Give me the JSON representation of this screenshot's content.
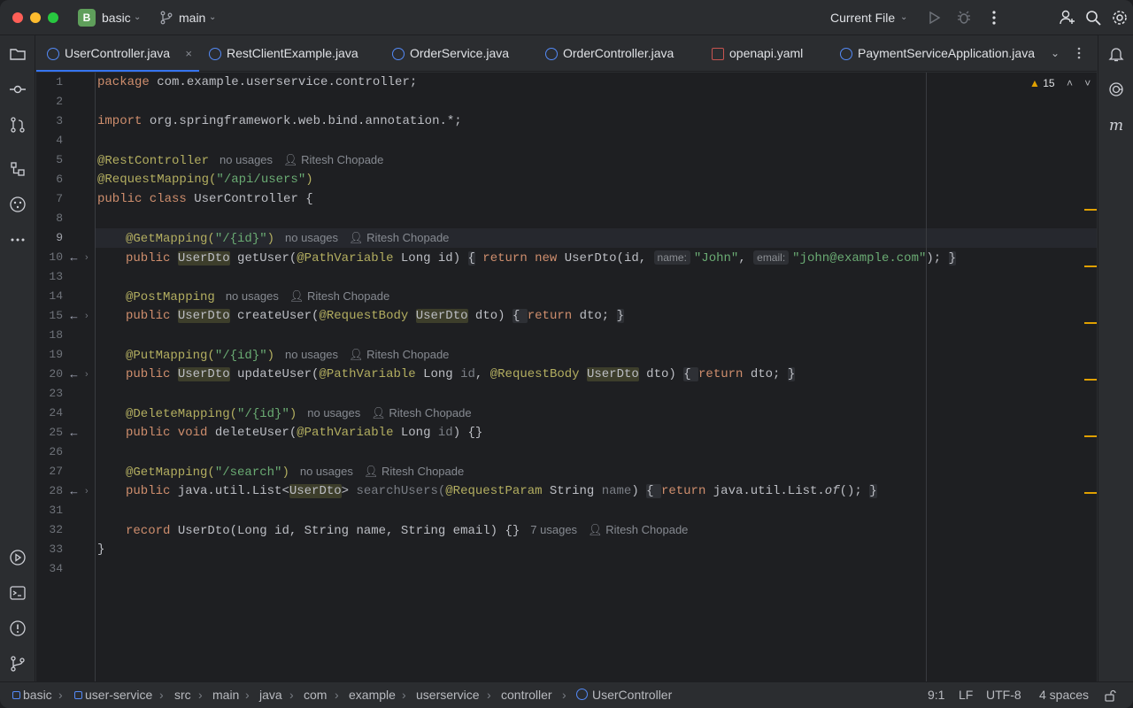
{
  "titlebar": {
    "project_badge": "B",
    "project_name": "basic",
    "branch": "main",
    "run_config": "Current File"
  },
  "tabs": [
    {
      "label": "UserController.java",
      "active": true
    },
    {
      "label": "RestClientExample.java"
    },
    {
      "label": "OrderService.java"
    },
    {
      "label": "OrderController.java"
    },
    {
      "label": "openapi.yaml"
    },
    {
      "label": "PaymentServiceApplication.java"
    }
  ],
  "editor": {
    "warning_count": "15",
    "author": "Ritesh Chopade",
    "no_usages": "no usages",
    "seven_usages": "7 usages",
    "line_numbers": [
      "1",
      "2",
      "3",
      "4",
      "5",
      "6",
      "7",
      "8",
      "9",
      "10",
      "13",
      "14",
      "15",
      "18",
      "19",
      "20",
      "23",
      "24",
      "25",
      "26",
      "27",
      "28",
      "31",
      "32",
      "33",
      "34"
    ],
    "code": {
      "l1_kw": "package",
      "l1_rest": " com.example.userservice.controller;",
      "l3_kw": "import",
      "l3_rest": " org.springframework.web.bind.annotation.*;",
      "l5_ann": "@RestController",
      "l6_ann": "@RequestMapping(",
      "l6_str": "\"/api/users\"",
      "l6_end": ")",
      "l7_kw": "public class",
      "l7_name": " UserController {",
      "l9_ann": "@GetMapping(",
      "l9_str": "\"/{id}\"",
      "l9_end": ")",
      "l10_kw": "public",
      "l10_type": "UserDto",
      "l10_method": " getUser(",
      "l10_ann": "@PathVariable",
      "l10_params": " Long id) ",
      "l10_body_open": "{",
      "l10_return": " return",
      "l10_new": " new",
      "l10_ctor": " UserDto(id, ",
      "l10_hint_name": "name:",
      "l10_str_name": "\"John\"",
      "l10_comma": ", ",
      "l10_hint_email": "email:",
      "l10_str_email": "\"john@example.com\"",
      "l10_tail": "); ",
      "l10_body_close": "}",
      "l14_ann": "@PostMapping",
      "l15_kw": "public",
      "l15_type": "UserDto",
      "l15_method": " createUser(",
      "l15_ann": "@RequestBody",
      "l15_type2": "UserDto",
      "l15_params": " dto) ",
      "l15_body": "{ ",
      "l15_return": "return",
      "l15_tail": " dto; ",
      "l15_close": "}",
      "l19_ann": "@PutMapping(",
      "l19_str": "\"/{id}\"",
      "l19_end": ")",
      "l20_kw": "public",
      "l20_type": "UserDto",
      "l20_method": " updateUser(",
      "l20_ann": "@PathVariable",
      "l20_mid": " Long ",
      "l20_id": "id",
      "l20_comma": ", ",
      "l20_ann2": "@RequestBody",
      "l20_type2": "UserDto",
      "l20_params": " dto) ",
      "l20_body": "{ ",
      "l20_return": "return",
      "l20_tail": " dto; ",
      "l20_close": "}",
      "l24_ann": "@DeleteMapping(",
      "l24_str": "\"/{id}\"",
      "l24_end": ")",
      "l25_kw": "public void",
      "l25_method": " deleteUser(",
      "l25_ann": "@PathVariable",
      "l25_params": " Long ",
      "l25_id": "id",
      "l25_tail": ") {}",
      "l27_ann": "@GetMapping(",
      "l27_str": "\"/search\"",
      "l27_end": ")",
      "l28_kw": "public",
      "l28_type": " java.util.List<",
      "l28_generic": "UserDto",
      "l28_gt": ">",
      "l28_method": " searchUsers(",
      "l28_ann": "@RequestParam",
      "l28_params": " String ",
      "l28_name": "name",
      "l28_close_paren": ") ",
      "l28_body": "{ ",
      "l28_return": "return",
      "l28_call": " java.util.List.",
      "l28_of": "of",
      "l28_tail": "(); ",
      "l28_close": "}",
      "l32_kw": "record",
      "l32_rest": " UserDto(Long id, String name, String email) {}",
      "l33": "}"
    }
  },
  "statusbar": {
    "breadcrumbs": [
      "basic",
      "user-service",
      "src",
      "main",
      "java",
      "com",
      "example",
      "userservice",
      "controller",
      "UserController"
    ],
    "position": "9:1",
    "line_sep": "LF",
    "encoding": "UTF-8",
    "indent": "4 spaces"
  },
  "colors": {
    "accent": "#3574f0",
    "keyword": "#cf8e6d",
    "annotation": "#b3ae60",
    "string": "#6aab73",
    "warning": "#e0a000"
  }
}
